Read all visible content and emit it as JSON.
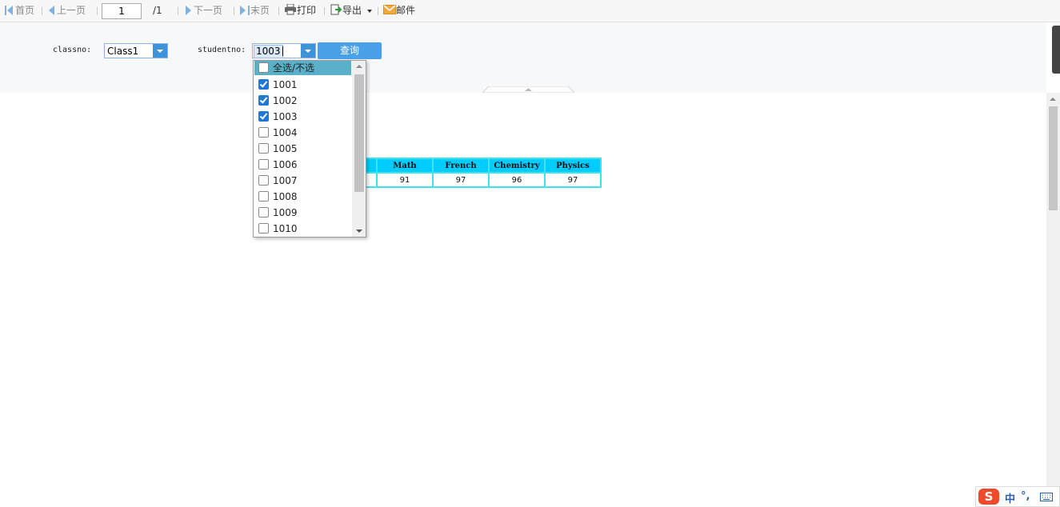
{
  "toolbar": {
    "first": "首页",
    "prev": "上一页",
    "page_value": "1",
    "total": "/1",
    "next": "下一页",
    "last": "末页",
    "print": "打印",
    "export": "导出",
    "mail": "邮件"
  },
  "params": {
    "classno_label": "classno:",
    "classno_value": "Class1",
    "studentno_label": "studentno:",
    "studentno_value": "1003",
    "query_label": "查询"
  },
  "dropdown": {
    "select_all": "全选/不选",
    "items": [
      {
        "label": "1001",
        "checked": true
      },
      {
        "label": "1002",
        "checked": true
      },
      {
        "label": "1003",
        "checked": true
      },
      {
        "label": "1004",
        "checked": false
      },
      {
        "label": "1005",
        "checked": false
      },
      {
        "label": "1006",
        "checked": false
      },
      {
        "label": "1007",
        "checked": false
      },
      {
        "label": "1008",
        "checked": false
      },
      {
        "label": "1009",
        "checked": false
      },
      {
        "label": "1010",
        "checked": false
      }
    ]
  },
  "report": {
    "headers": [
      "",
      "Math",
      "French",
      "Chemistry",
      "Physics"
    ],
    "row": [
      "",
      "91",
      "97",
      "96",
      "97"
    ]
  },
  "ime": {
    "logo": "S",
    "mode": "中",
    "punct": "°,"
  },
  "colors": {
    "header_bg": "#00ccff",
    "border": "#3fe3ec",
    "accent": "#4aa0e6",
    "dropdown_select_all": "#5bb0c9"
  }
}
